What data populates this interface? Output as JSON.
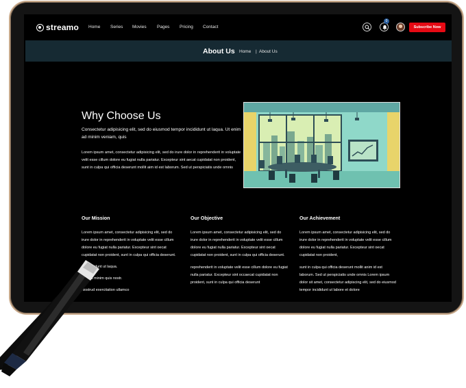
{
  "header": {
    "logo_text": "streamo",
    "nav": [
      "Home",
      "Series",
      "Movies",
      "Pages",
      "Pricing",
      "Contact"
    ],
    "notification_count": "0",
    "subscribe_label": "Subscribe Now"
  },
  "banner": {
    "title": "About Us",
    "breadcrumb_home": "Home",
    "breadcrumb_separator": "|",
    "breadcrumb_current": "About Us"
  },
  "why": {
    "title": "Why Choose Us",
    "lead": "Consectetur adipisicing elit, sed do eiusmod tempor incididunt ut laqua. Ut enim ad minim veniam, quis",
    "body": "Lorem ipsum amet, consectetur adipisicing elit, sed do irure dolor in reprehenderit in voluptate velit esse cillum dolore eu fugiat nulla pariatur. Excepteur sint aecat cupidatat non proident, sunt in culpa qui officia deserunt mollit aim id est laborum. Sed ut perspiciatis unde omnis"
  },
  "columns": [
    {
      "title": "Our Mission",
      "p1": "Lorem ipsum amet, consectetur adipisicing elit, sed do irure dolor in reprehenderit in voluptate velit esse cillum dolore eu fugiat nulla pariatur. Excepteur sint oecat cupidatat non proident, sunt in culpa qui officia deserunt.",
      "p2_lines": [
        "pr incididunt ut laqua.",
        "nim ad minim quis nostr.",
        "Nostrud exercitation ullamco"
      ]
    },
    {
      "title": "Our Objective",
      "p1": "Lorem ipsum amet, consectetur adipisicing elit, sed do irure dolor in reprehenderit in voluptate velit esse cillum dolore eu fugiat nulla pariatur. Excepteur sint oecat cupidatat non proident, sunt in culpa qui officia deserunt.",
      "p2": "reprehenderit in voluptate velit esse cillum dolore eu fugiat nulla pariatur. Excepteur sint occaecat cupidatat non proident, sunt in culpa qui officia deserunt"
    },
    {
      "title": "Our Achievement",
      "p1": "Lorem ipsum amet, consectetur adipisicing elit, sed do irure dolor in reprehenderit in voluptate velit esse cillum dolore eu fugiat nulla pariatur. Excepteur sint oecat cupidatat non proident,",
      "p2": "sunt in culpa qui officia deserunt mollit anim id est laborum. Sed ut perspiciatis unde omnis Lorem ipsum dolor sit amet, consectetur adipiscing elit, sed do eiusmod tempor incididunt ut labore et dolore"
    }
  ],
  "colors": {
    "accent": "#e60a14",
    "banner_bg": "#162a33",
    "frame": "#c8a98a",
    "page_bg": "#000000"
  }
}
